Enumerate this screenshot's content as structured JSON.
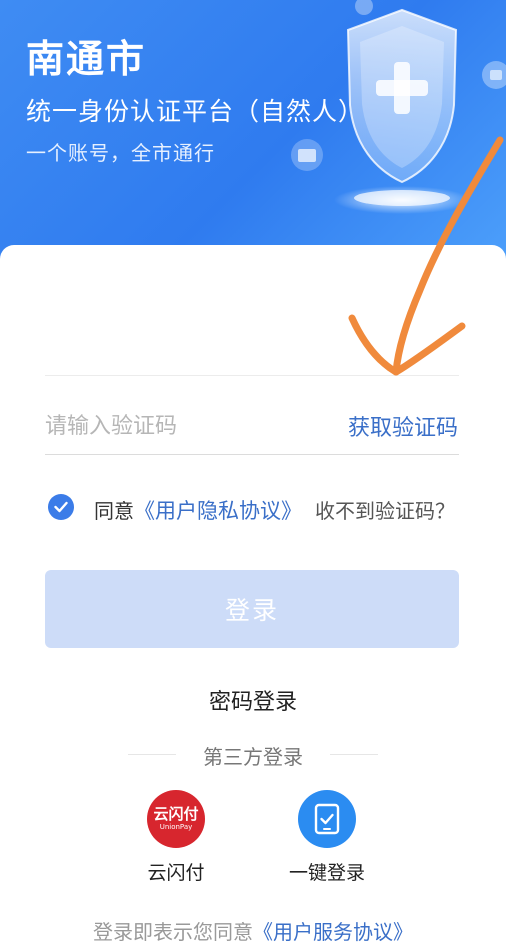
{
  "header": {
    "city": "南通市",
    "platform": "统一身份认证平台（自然人）",
    "slogan": "一个账号，全市通行"
  },
  "form": {
    "code_placeholder": "请输入验证码",
    "get_code_label": "获取验证码",
    "agree_prefix": "同意",
    "agree_link": "《用户隐私协议》",
    "no_code_label": "收不到验证码？",
    "login_label": "登录",
    "password_login_label": "密码登录"
  },
  "third_party": {
    "title": "第三方登录",
    "options": [
      {
        "label": "云闪付",
        "logo_text": "云闪付",
        "logo_sub": "UnionPay",
        "icon": "unionpay-icon"
      },
      {
        "label": "一键登录",
        "icon": "phone-check-icon"
      }
    ]
  },
  "footer": {
    "prefix": "登录即表示您同意",
    "link": "《用户服务协议》"
  },
  "colors": {
    "header_blue": "#2f7bef",
    "link_blue": "#3a6fc8",
    "button_disabled": "#cddcf8",
    "unionpay_red": "#d7262e",
    "annotation_orange": "#f08a3c"
  }
}
